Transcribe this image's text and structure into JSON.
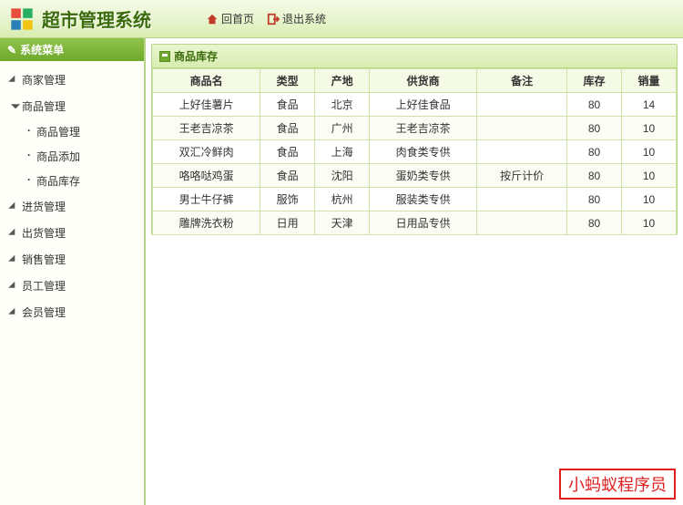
{
  "header": {
    "app_title": "超市管理系统",
    "home_link": "回首页",
    "exit_link": "退出系统"
  },
  "sidebar": {
    "title": "系统菜单",
    "items": [
      {
        "label": "商家管理",
        "expanded": false
      },
      {
        "label": "商品管理",
        "expanded": true,
        "children": [
          {
            "label": "商品管理"
          },
          {
            "label": "商品添加"
          },
          {
            "label": "商品库存"
          }
        ]
      },
      {
        "label": "进货管理",
        "expanded": false
      },
      {
        "label": "出货管理",
        "expanded": false
      },
      {
        "label": "销售管理",
        "expanded": false
      },
      {
        "label": "员工管理",
        "expanded": false
      },
      {
        "label": "会员管理",
        "expanded": false
      }
    ]
  },
  "panel": {
    "title": "商品库存",
    "columns": [
      "商品名",
      "类型",
      "产地",
      "供货商",
      "备注",
      "库存",
      "销量"
    ],
    "rows": [
      [
        "上好佳薯片",
        "食品",
        "北京",
        "上好佳食品",
        "",
        "80",
        "14"
      ],
      [
        "王老吉凉茶",
        "食品",
        "广州",
        "王老吉凉茶",
        "",
        "80",
        "10"
      ],
      [
        "双汇冷鲜肉",
        "食品",
        "上海",
        "肉食类专供",
        "",
        "80",
        "10"
      ],
      [
        "咯咯哒鸡蛋",
        "食品",
        "沈阳",
        "蛋奶类专供",
        "按斤计价",
        "80",
        "10"
      ],
      [
        "男士牛仔裤",
        "服饰",
        "杭州",
        "服装类专供",
        "",
        "80",
        "10"
      ],
      [
        "雕牌洗衣粉",
        "日用",
        "天津",
        "日用品专供",
        "",
        "80",
        "10"
      ]
    ]
  },
  "watermark": "小蚂蚁程序员"
}
